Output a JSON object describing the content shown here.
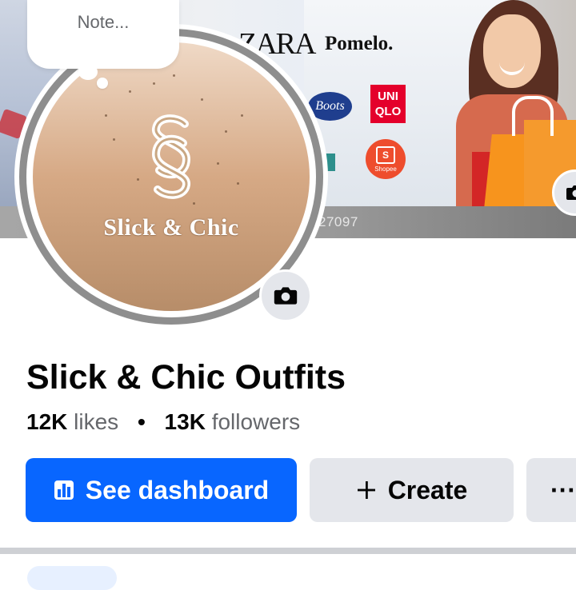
{
  "note": {
    "placeholder": "Note..."
  },
  "cover": {
    "brands": [
      "ZARA",
      "Pomelo.",
      "Boots",
      "UNIQLO",
      "Shopee"
    ],
    "uniqlo_lines": [
      "UNI",
      "QLO"
    ],
    "number_text": "27097"
  },
  "profile": {
    "logo_text": "Slick & Chic"
  },
  "page": {
    "name": "Slick & Chic Outfits",
    "likes_count": "12K",
    "likes_label": "likes",
    "separator": "•",
    "followers_count": "13K",
    "followers_label": "followers"
  },
  "actions": {
    "dashboard_label": "See dashboard",
    "create_label": "Create",
    "more_label": "···"
  },
  "icons": {
    "cover_camera": "camera-icon",
    "profile_camera": "camera-icon",
    "dashboard": "bar-chart-icon",
    "create": "plus-icon",
    "more": "more-icon"
  },
  "colors": {
    "primary": "#0866ff",
    "secondary_button": "#e4e6eb",
    "text_primary": "#050505",
    "text_secondary": "#65676b"
  }
}
